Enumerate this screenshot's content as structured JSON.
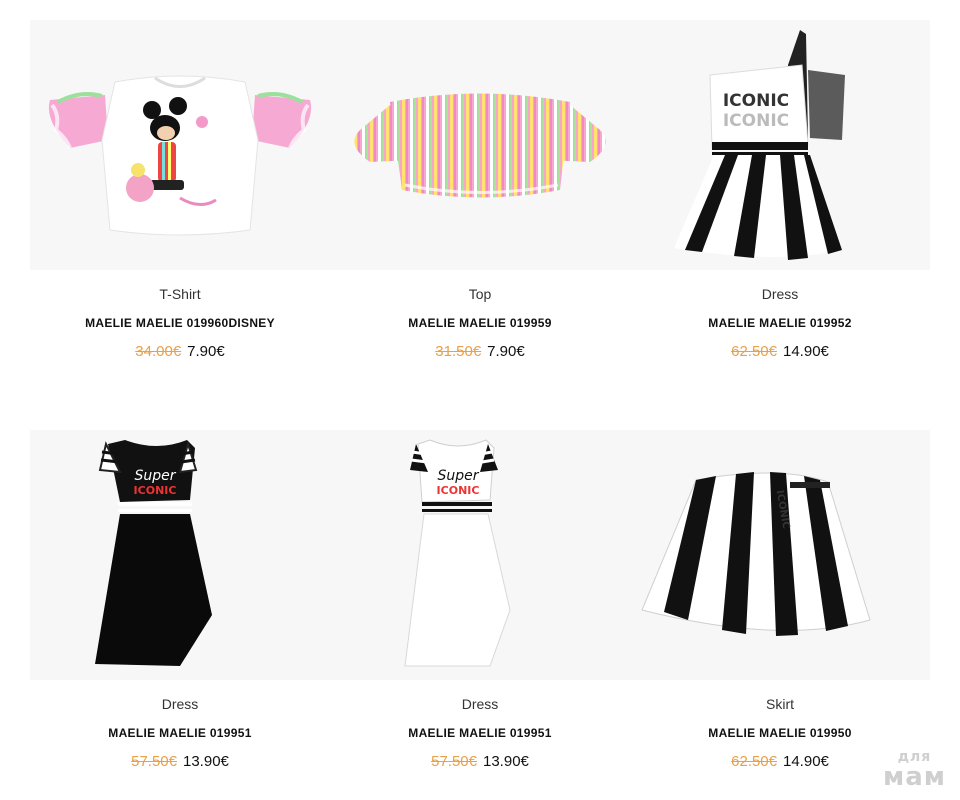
{
  "products": [
    {
      "category": "T-Shirt",
      "name": "MAELIE MAELIE 019960DISNEY",
      "old_price": "34.00€",
      "new_price": "7.90€",
      "image": "tshirt-image"
    },
    {
      "category": "Top",
      "name": "MAELIE MAELIE 019959",
      "old_price": "31.50€",
      "new_price": "7.90€",
      "image": "top-image"
    },
    {
      "category": "Dress",
      "name": "MAELIE MAELIE 019952",
      "old_price": "62.50€",
      "new_price": "14.90€",
      "image": "dress-image"
    },
    {
      "category": "Dress",
      "name": "MAELIE MAELIE 019951",
      "old_price": "57.50€",
      "new_price": "13.90€",
      "image": "dress-image"
    },
    {
      "category": "Dress",
      "name": "MAELIE MAELIE 019951",
      "old_price": "57.50€",
      "new_price": "13.90€",
      "image": "dress-image"
    },
    {
      "category": "Skirt",
      "name": "MAELIE MAELIE 019950",
      "old_price": "62.50€",
      "new_price": "14.90€",
      "image": "skirt-image"
    }
  ],
  "graphics": {
    "dress1_text": "ICONIC",
    "dress2_text": "Super",
    "dress2_sub": "ICONIC",
    "skirt_text": "ICONIC"
  },
  "watermark": {
    "line1": "для",
    "line2": "мам"
  },
  "colors": {
    "old_price": "#e8a04a",
    "card_bg": "#f7f7f7"
  }
}
